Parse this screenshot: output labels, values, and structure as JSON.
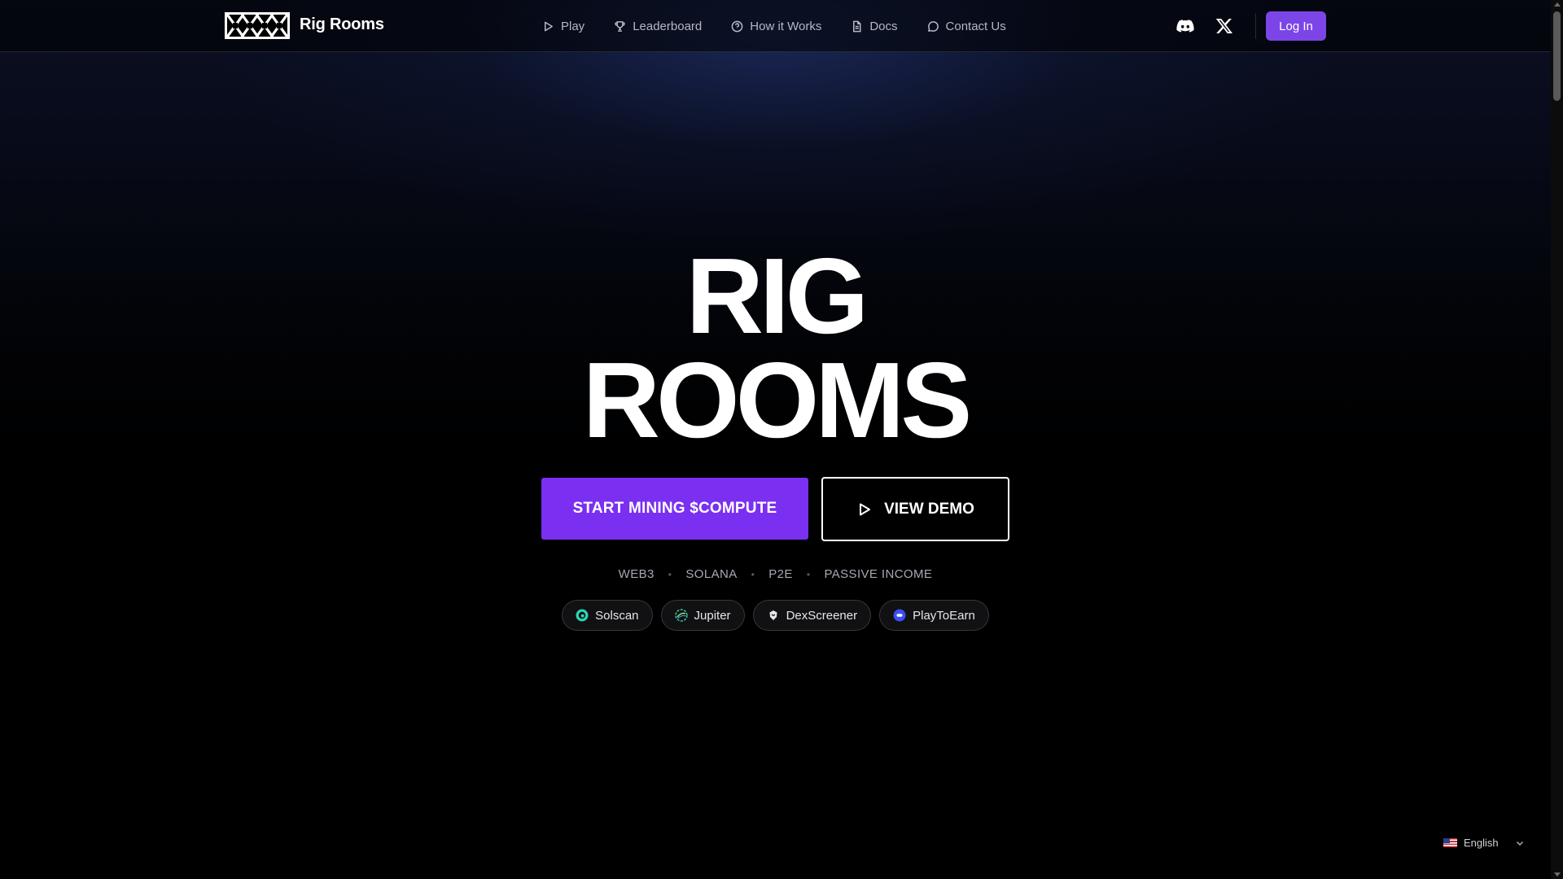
{
  "header": {
    "brand": "Rig Rooms",
    "nav": [
      {
        "label": "Play",
        "icon": "play-icon"
      },
      {
        "label": "Leaderboard",
        "icon": "trophy-icon"
      },
      {
        "label": "How it Works",
        "icon": "help-circle-icon"
      },
      {
        "label": "Docs",
        "icon": "document-icon"
      },
      {
        "label": "Contact Us",
        "icon": "message-icon"
      }
    ],
    "social": [
      "discord-icon",
      "x-icon"
    ],
    "login_label": "Log In"
  },
  "hero": {
    "title_line1": "RIG",
    "title_line2": "ROOMS",
    "primary_cta": "START MINING $COMPUTE",
    "secondary_cta": "VIEW DEMO",
    "tags": [
      "WEB3",
      "SOLANA",
      "P2E",
      "PASSIVE INCOME"
    ],
    "partners": [
      {
        "label": "Solscan",
        "icon": "solscan-icon"
      },
      {
        "label": "Jupiter",
        "icon": "jupiter-icon"
      },
      {
        "label": "DexScreener",
        "icon": "dexscreener-icon"
      },
      {
        "label": "PlayToEarn",
        "icon": "playtoearn-icon"
      }
    ]
  },
  "language": {
    "selected": "English",
    "flag": "us-flag-icon"
  },
  "colors": {
    "accent": "#7b2ff0",
    "login": "#7b45e8",
    "background": "#000000"
  }
}
